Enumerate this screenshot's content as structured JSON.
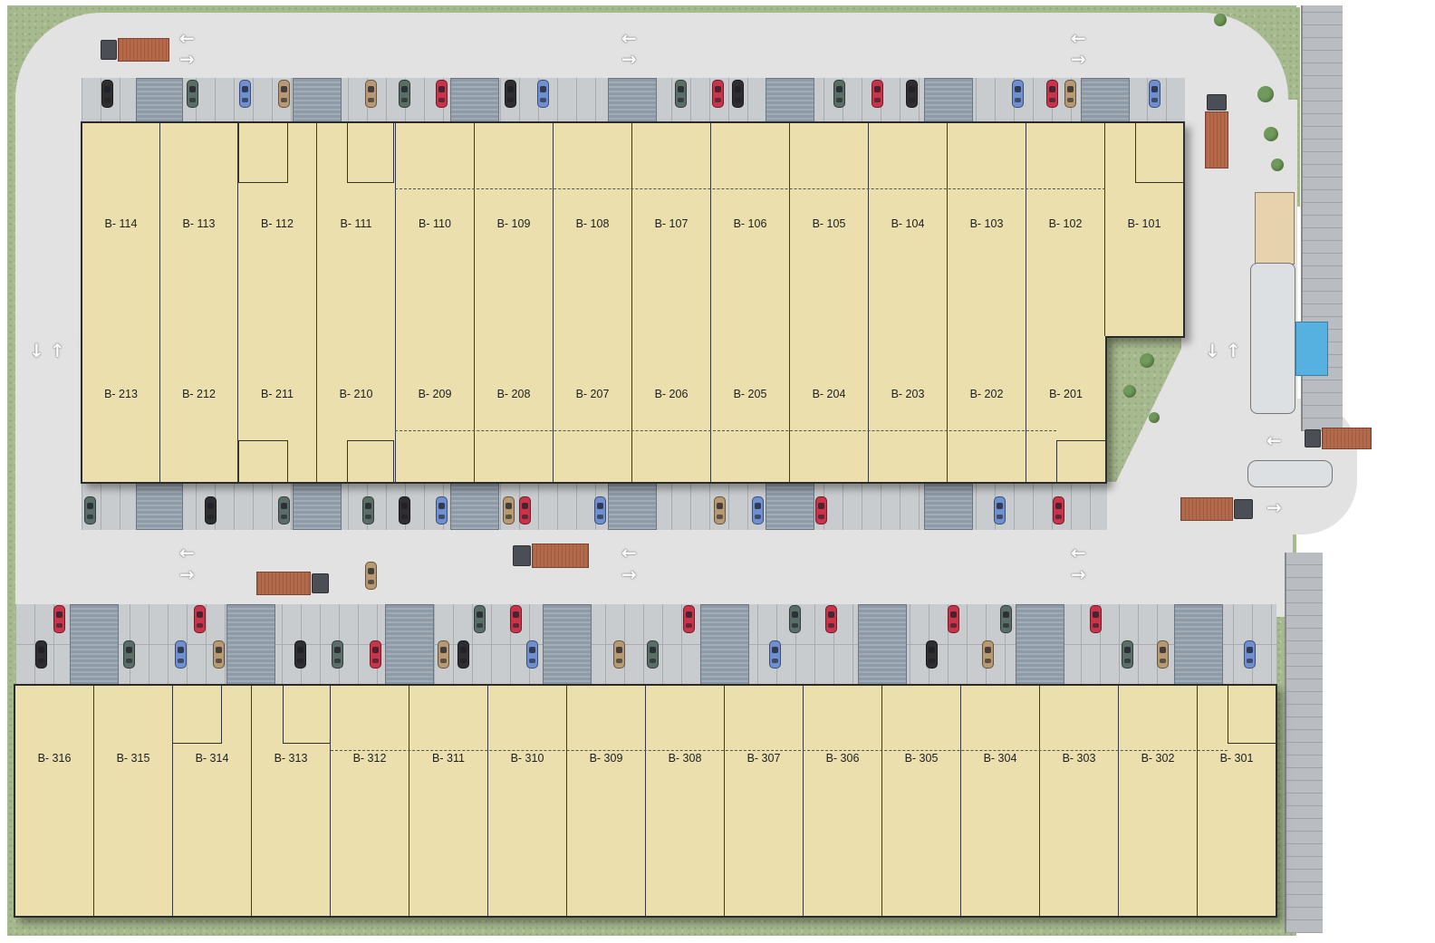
{
  "plan": {
    "block_b1": {
      "units": [
        {
          "label": "B- 114"
        },
        {
          "label": "B- 113"
        },
        {
          "label": "B- 112"
        },
        {
          "label": "B- 111"
        },
        {
          "label": "B- 110"
        },
        {
          "label": "B- 109"
        },
        {
          "label": "B- 108"
        },
        {
          "label": "B- 107"
        },
        {
          "label": "B- 106"
        },
        {
          "label": "B- 105"
        },
        {
          "label": "B- 104"
        },
        {
          "label": "B- 103"
        },
        {
          "label": "B- 102"
        },
        {
          "label": "B- 101"
        }
      ]
    },
    "block_b2": {
      "units": [
        {
          "label": "B- 213"
        },
        {
          "label": "B- 212"
        },
        {
          "label": "B- 211"
        },
        {
          "label": "B- 210"
        },
        {
          "label": "B- 209"
        },
        {
          "label": "B- 208"
        },
        {
          "label": "B- 207"
        },
        {
          "label": "B- 206"
        },
        {
          "label": "B- 205"
        },
        {
          "label": "B- 204"
        },
        {
          "label": "B- 203"
        },
        {
          "label": "B- 202"
        },
        {
          "label": "B- 201"
        }
      ]
    },
    "block_b3": {
      "units": [
        {
          "label": "B- 316"
        },
        {
          "label": "B- 315"
        },
        {
          "label": "B- 314"
        },
        {
          "label": "B- 313"
        },
        {
          "label": "B- 312"
        },
        {
          "label": "B- 311"
        },
        {
          "label": "B- 310"
        },
        {
          "label": "B- 309"
        },
        {
          "label": "B- 308"
        },
        {
          "label": "B- 307"
        },
        {
          "label": "B- 306"
        },
        {
          "label": "B- 305"
        },
        {
          "label": "B- 304"
        },
        {
          "label": "B- 303"
        },
        {
          "label": "B- 302"
        },
        {
          "label": "B- 301"
        }
      ]
    },
    "icons": {
      "traffic_arrow_left": "←",
      "traffic_arrow_right": "→",
      "traffic_arrow_up": "↑",
      "traffic_arrow_down": "↓"
    },
    "colors": {
      "unit_fill": "#ebdfae",
      "road": "#e2e2e2",
      "parking": "#c9ccce",
      "loading_dock": "#8e9aa6",
      "grass": "#a7b98f",
      "container": "#b46a4a",
      "car_colors": [
        "#2e2e30",
        "#c9344a",
        "#6e8fd0",
        "#5a6e68",
        "#b89a72"
      ]
    }
  }
}
